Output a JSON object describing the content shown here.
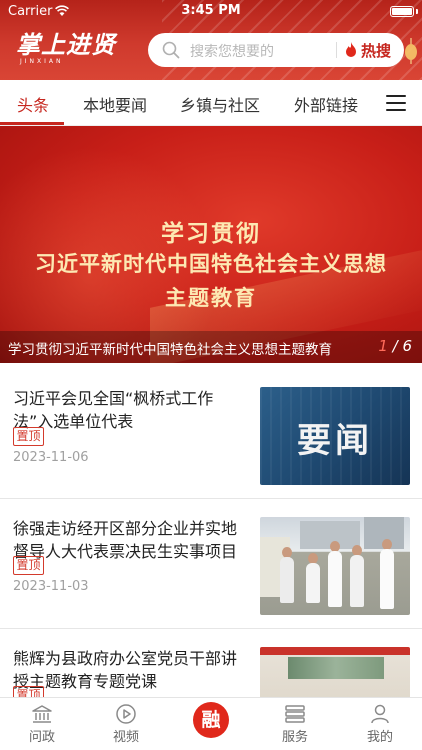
{
  "status_bar": {
    "carrier": "Carrier",
    "time": "3:45 PM"
  },
  "header": {
    "logo_text": "掌上进贤",
    "logo_sub": "JINXIAN",
    "search_placeholder": "搜索您想要的",
    "hot_search_label": "热搜",
    "colors": {
      "brand": "#c6271f",
      "header_bg": "#cf3a2d"
    }
  },
  "tabs": [
    {
      "label": "头条",
      "active": true
    },
    {
      "label": "本地要闻",
      "active": false
    },
    {
      "label": "乡镇与社区",
      "active": false
    },
    {
      "label": "外部链接",
      "active": false
    }
  ],
  "banner": {
    "line1": "学习贯彻",
    "line2": "习近平新时代中国特色社会主义思想",
    "line3": "主题教育",
    "caption": "学习贯彻习近平新时代中国特色社会主义思想主题教育",
    "pager_current": "1",
    "pager_total": "6"
  },
  "news": [
    {
      "title": "习近平会见全国“枫桥式工作法”入选单位代表",
      "badge": "置顶",
      "date": "2023-11-06",
      "thumb_text": "要闻"
    },
    {
      "title": "徐强走访经开区部分企业并实地督导人大代表票决民生实事项目",
      "badge": "置顶",
      "date": "2023-11-03"
    },
    {
      "title": "熊辉为县政府办公室党员干部讲授主题教育专题党课",
      "badge": "置顶",
      "date": ""
    }
  ],
  "tabbar": {
    "items": [
      {
        "label": "问政",
        "icon": "bank-icon"
      },
      {
        "label": "视频",
        "icon": "play-icon"
      },
      {
        "label": "融",
        "icon": "center-rong-icon"
      },
      {
        "label": "服务",
        "icon": "list-icon"
      },
      {
        "label": "我的",
        "icon": "user-icon"
      }
    ]
  }
}
